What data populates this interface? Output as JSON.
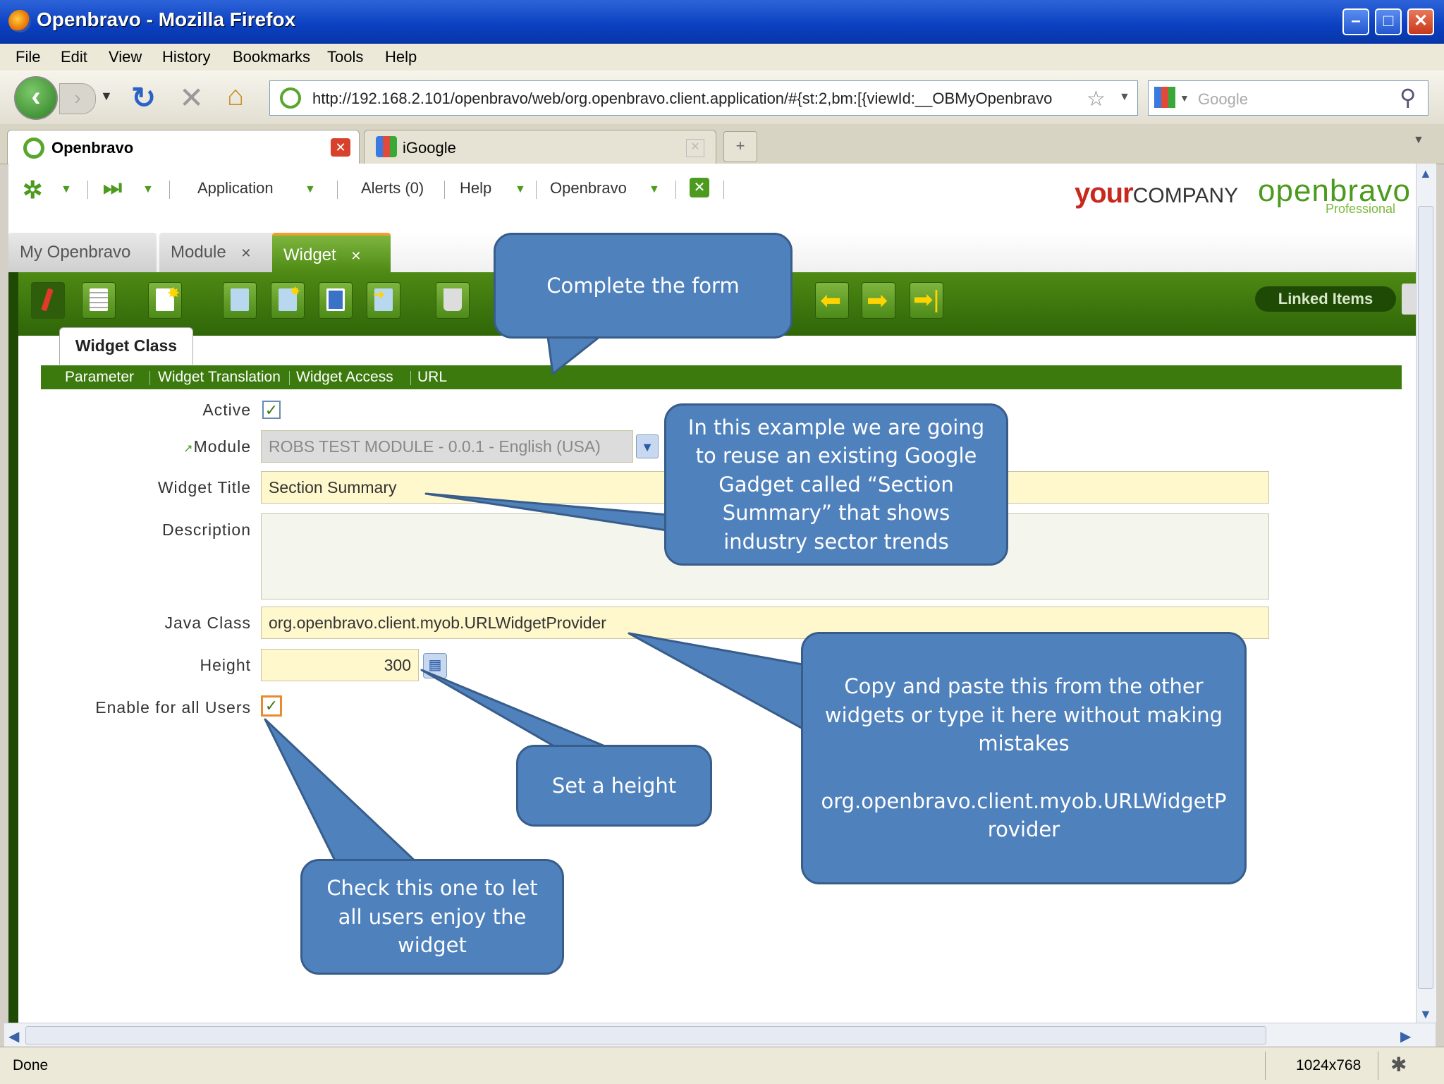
{
  "window": {
    "title": "Openbravo - Mozilla Firefox"
  },
  "menubar": [
    "File",
    "Edit",
    "View",
    "History",
    "Bookmarks",
    "Tools",
    "Help"
  ],
  "navbar": {
    "url": "http://192.168.2.101/openbravo/web/org.openbravo.client.application/#{st:2,bm:[{viewId:__OBMyOpenbravo",
    "search_placeholder": "Google"
  },
  "browser_tabs": [
    {
      "label": "Openbravo",
      "active": true
    },
    {
      "label": "iGoogle",
      "active": false
    }
  ],
  "app_header": {
    "menu": [
      "Application",
      "Alerts (0)",
      "Help",
      "Openbravo"
    ],
    "brand_your": "your",
    "brand_company": "COMPANY",
    "brand_ob": "openbravo",
    "brand_edition": "Professional"
  },
  "window_tabs": [
    {
      "label": "My Openbravo",
      "closable": false
    },
    {
      "label": "Module",
      "closable": true
    },
    {
      "label": "Widget",
      "closable": true,
      "active": true
    }
  ],
  "toolbar": {
    "linked_items": "Linked Items"
  },
  "form": {
    "section_tab": "Widget Class",
    "subtabs": [
      "Parameter",
      "Widget Translation",
      "Widget Access",
      "URL"
    ],
    "labels": {
      "active": "Active",
      "module": "Module",
      "widget_title": "Widget Title",
      "description": "Description",
      "java_class": "Java Class",
      "height": "Height",
      "enable_all": "Enable for all Users"
    },
    "values": {
      "active": true,
      "module": "ROBS TEST MODULE - 0.0.1 - English (USA)",
      "widget_title": "Section Summary",
      "description": "",
      "java_class": "org.openbravo.client.myob.URLWidgetProvider",
      "height": "300",
      "enable_all": true
    }
  },
  "callouts": {
    "complete_form": "Complete the form",
    "example": "In this example we are going to reuse an existing Google Gadget called “Section Summary” that shows industry sector trends",
    "copy_paste": "Copy and paste this from the other widgets or type it here without making mistakes\n\norg.openbravo.client.myob.URLWidgetP rovider",
    "set_height": "Set a height",
    "check_this": "Check this one to let all users enjoy the widget"
  },
  "status": {
    "text": "Done",
    "resolution": "1024x768"
  },
  "colors": {
    "callout": "#4f81bd",
    "callout_border": "#385d8a",
    "toolbar_green": "#3c7a0e",
    "field_yellow": "#fff8cc"
  }
}
